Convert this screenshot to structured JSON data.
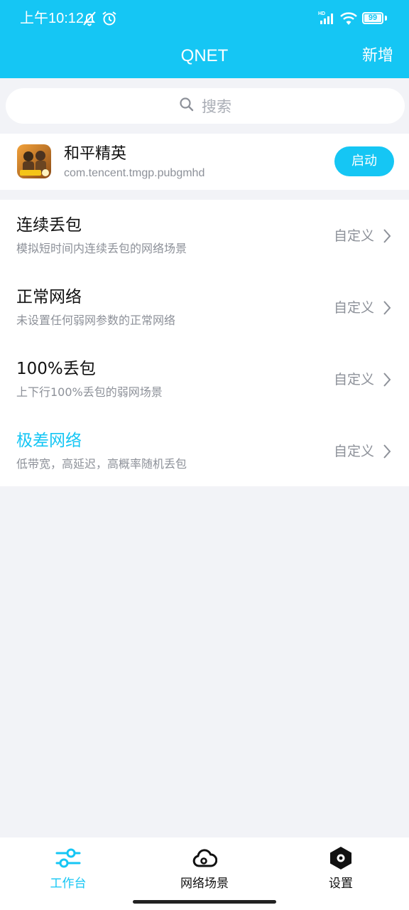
{
  "status_bar": {
    "time": "上午10:12",
    "icons": [
      "mute-icon",
      "alarm-icon",
      "hd-signal-icon",
      "wifi-icon",
      "battery-icon"
    ],
    "battery_level": "99"
  },
  "header": {
    "title": "QNET",
    "action_label": "新增"
  },
  "search": {
    "placeholder": "搜索"
  },
  "app": {
    "name": "和平精英",
    "package": "com.tencent.tmgp.pubgmhd",
    "launch_label": "启动"
  },
  "scenarios": [
    {
      "title": "连续丢包",
      "subtitle": "模拟短时间内连续丢包的网络场景",
      "action": "自定义",
      "selected": false
    },
    {
      "title": "正常网络",
      "subtitle": "未设置任何弱网参数的正常网络",
      "action": "自定义",
      "selected": false
    },
    {
      "title": "100%丢包",
      "subtitle": "上下行100%丢包的弱网场景",
      "action": "自定义",
      "selected": false
    },
    {
      "title": "极差网络",
      "subtitle": "低带宽，高延迟，高概率随机丢包",
      "action": "自定义",
      "selected": true
    }
  ],
  "tabbar": {
    "tabs": [
      {
        "label": "工作台",
        "icon": "sliders-icon",
        "active": true
      },
      {
        "label": "网络场景",
        "icon": "cloud-icon",
        "active": false
      },
      {
        "label": "设置",
        "icon": "hexagon-settings-icon",
        "active": false
      }
    ]
  },
  "colors": {
    "accent": "#15c6f4",
    "background": "#f2f3f7",
    "secondary_text": "#8d9199"
  }
}
